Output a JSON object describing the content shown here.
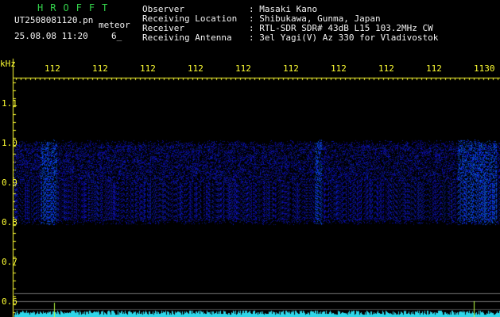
{
  "header": {
    "brand": "HROFFT",
    "filename": "UT2508081120.pn",
    "mode": "meteor",
    "datetime": "25.08.08 11:20",
    "extra": "6_"
  },
  "info": {
    "rows": [
      {
        "label": "Observer",
        "value": ": Masaki Kano"
      },
      {
        "label": "Receiving Location",
        "value": ": Shibukawa, Gunma, Japan"
      },
      {
        "label": "Receiver",
        "value": ": RTL-SDR SDR# 43dB L15 103.2MHz CW"
      },
      {
        "label": "Receiving Antenna",
        "value": ": 3el Yagi(V) Az 330 for Vladivostok"
      }
    ]
  },
  "axis": {
    "unit": "kHz",
    "x_ticks": [
      "112",
      "112",
      "112",
      "112",
      "112",
      "112",
      "112",
      "112",
      "112",
      "1130"
    ],
    "y_ticks": [
      "1.1",
      "1.0",
      "0.9",
      "0.8",
      "0.7",
      "0.6"
    ]
  },
  "colors": {
    "background": "#000000",
    "label_yellow": "#ffff33",
    "header_green": "#33d04a",
    "signal_blue": "#3a4cff",
    "baseline_cyan": "#2fd6e8"
  }
}
